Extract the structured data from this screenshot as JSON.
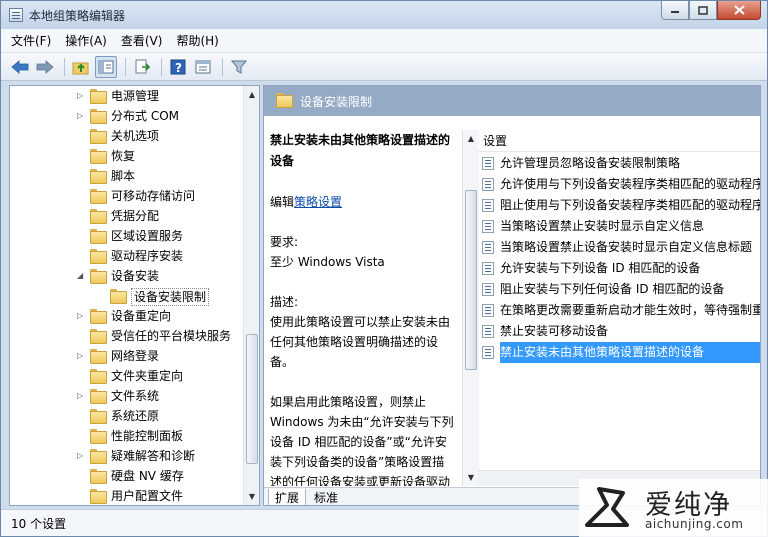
{
  "window": {
    "title": "本地组策略编辑器",
    "controls": [
      "minimize-icon",
      "maximize-icon",
      "close-icon"
    ]
  },
  "menu": [
    "文件(F)",
    "操作(A)",
    "查看(V)",
    "帮助(H)"
  ],
  "toolbar": {
    "icons": [
      "back-arrow-icon",
      "forward-arrow-icon",
      "up-folder-icon",
      "show-hide-tree-icon",
      "export-list-icon",
      "help-icon",
      "properties-icon",
      "filter-icon"
    ]
  },
  "tree": {
    "items": [
      {
        "label": "电源管理",
        "expandable": true
      },
      {
        "label": "分布式 COM",
        "expandable": true
      },
      {
        "label": "关机选项",
        "expandable": false
      },
      {
        "label": "恢复",
        "expandable": false
      },
      {
        "label": "脚本",
        "expandable": false
      },
      {
        "label": "可移动存储访问",
        "expandable": false
      },
      {
        "label": "凭据分配",
        "expandable": false
      },
      {
        "label": "区域设置服务",
        "expandable": false
      },
      {
        "label": "驱动程序安装",
        "expandable": false
      },
      {
        "label": "设备安装",
        "expandable": true,
        "expanded": true
      },
      {
        "label": "设备安装限制",
        "expandable": false,
        "child": true,
        "selected": true
      },
      {
        "label": "设备重定向",
        "expandable": true
      },
      {
        "label": "受信任的平台模块服务",
        "expandable": false
      },
      {
        "label": "网络登录",
        "expandable": true
      },
      {
        "label": "文件夹重定向",
        "expandable": false
      },
      {
        "label": "文件系统",
        "expandable": true
      },
      {
        "label": "系统还原",
        "expandable": false
      },
      {
        "label": "性能控制面板",
        "expandable": false
      },
      {
        "label": "疑难解答和诊断",
        "expandable": true
      },
      {
        "label": "硬盘 NV 缓存",
        "expandable": false
      },
      {
        "label": "用户配置文件",
        "expandable": false
      }
    ]
  },
  "right": {
    "header_title": "设备安装限制",
    "description": {
      "heading": "禁止安装未由其他策略设置描述的设备",
      "edit_prefix": "编辑",
      "edit_link": "策略设置",
      "requirements_label": "要求:",
      "requirements_value": "至少 Windows Vista",
      "description_label": "描述:",
      "description_text": "使用此策略设置可以禁止安装未由任何其他策略设置明确描述的设备。",
      "detail_text": "如果启用此策略设置，则禁止 Windows 为未由“允许安装与下列设备 ID 相匹配的设备”或“允许安装下列设备类的设备”策略设置描述的任何设备安装或更新设备驱动程序"
    },
    "settings_column": "设置",
    "settings": [
      "允许管理员忽略设备安装限制策略",
      "允许使用与下列设备安装程序类相匹配的驱动程序",
      "阻止使用与下列设备安装程序类相匹配的驱动程序",
      "当策略设置禁止安装时显示自定义信息",
      "当策略设置禁止设备安装时显示自定义信息标题",
      "允许安装与下列设备 ID 相匹配的设备",
      "阻止安装与下列任何设备 ID 相匹配的设备",
      "在策略更改需要重新启动才能生效时，等待强制重",
      "禁止安装可移动设备",
      "禁止安装未由其他策略设置描述的设备"
    ],
    "selected_setting_index": 9,
    "tabs": [
      "扩展",
      "标准"
    ],
    "active_tab": "扩展"
  },
  "status": {
    "text": "10 个设置"
  },
  "watermark": {
    "title": "爱纯净",
    "url": "aichunjing.com"
  },
  "colors": {
    "header_bar": "#95abc5",
    "selection": "#3399ff",
    "link": "#0b4aa8"
  }
}
